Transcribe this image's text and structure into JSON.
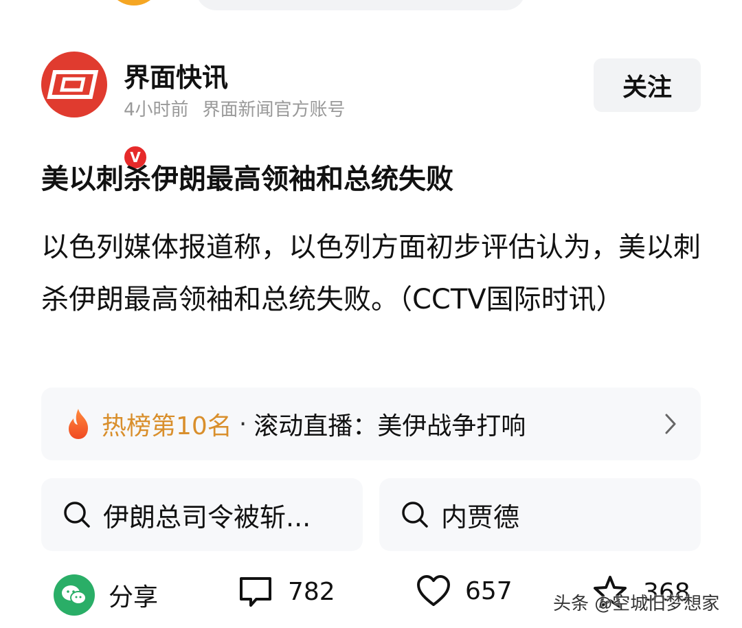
{
  "author": {
    "name": "界面快讯",
    "time": "4小时前",
    "desc": "界面新闻官方账号",
    "verified_mark": "V",
    "follow_label": "关注"
  },
  "post": {
    "title": "美以刺杀伊朗最高领袖和总统失败",
    "body": "以色列媒体报道称，以色列方面初步评估认为，美以刺杀伊朗最高领袖和总统失败。（CCTV国际时讯）"
  },
  "hot": {
    "rank": "热榜第10名",
    "separator": "·",
    "topic": "滚动直播：美伊战争打响"
  },
  "searches": [
    {
      "text": "伊朗总司令被斩..."
    },
    {
      "text": "内贾德"
    }
  ],
  "actions": {
    "share_label": "分享",
    "comment_count": "782",
    "like_count": "657",
    "fav_count": "368"
  },
  "watermark": "头条 @空城旧梦想家",
  "colors": {
    "brand_red": "#e03b2f",
    "hot_orange": "#d98f2c",
    "wechat_green": "#2aae67"
  }
}
